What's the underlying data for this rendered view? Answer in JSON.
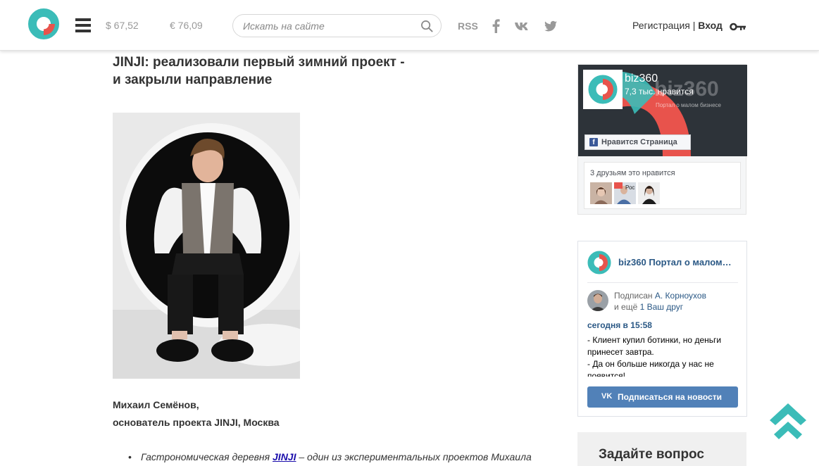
{
  "header": {
    "usd_rate": "$ 67,52",
    "eur_rate": "€ 76,09",
    "search_placeholder": "Искать на сайте",
    "rss_label": "RSS",
    "register_label": "Регистрация",
    "auth_separator": " | ",
    "login_label": "Вход"
  },
  "article": {
    "title_line1": "JINJI: реализовали первый зимний проект -",
    "title_line2": "и закрыли направление",
    "author_name": "Михаил Семёнов,",
    "author_role": "основатель проекта JINJI, Москва",
    "bullet_prefix": "Гастрономическая деревня ",
    "bullet_link": "JINJI",
    "bullet_suffix": " – один из экспериментальных проектов Михаила"
  },
  "fb_widget": {
    "page_name": "biz360",
    "likes": "7,3 тыс. нравится",
    "cover_text": "biz360",
    "cover_subtext": "Портал о малом бизнесе",
    "like_button": "Нравится Страница",
    "friends_text": "3 друзьям это нравится",
    "friend_badge": "Рос"
  },
  "vk_widget": {
    "title": "biz360 Портал о малом…",
    "subscribed_prefix": "Подписан ",
    "subscribed_name": "А. Корноухов",
    "and_more_prefix": "и ещё ",
    "and_more_link": "1 Ваш друг",
    "post_time": "сегодня в 15:58",
    "post_line1": "- Клиент купил ботинки, но деньги",
    "post_line2": "принесет завтра.",
    "post_line3": "- Да он больше никогда у нас не",
    "post_line4": "появится!",
    "subscribe_button": "Подписаться на новости",
    "vk_glyph": "VK"
  },
  "ask_block": {
    "title": "Задайте вопрос"
  },
  "colors": {
    "brand_teal": "#3bbcb8",
    "brand_red": "#e8534c",
    "vk_blue": "#5181b8",
    "fb_blue": "#3b5998"
  }
}
